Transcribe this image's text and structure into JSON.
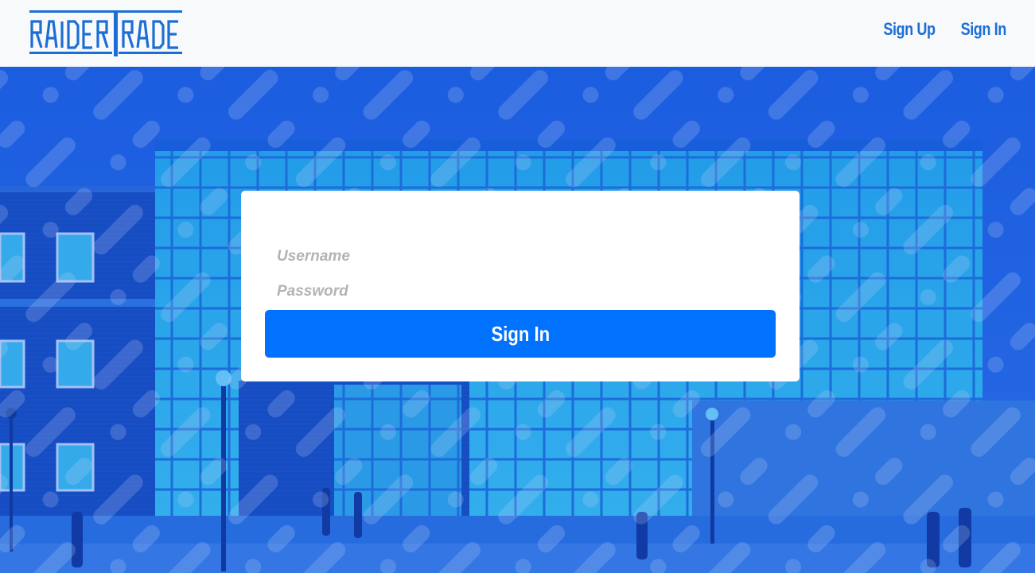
{
  "brand": {
    "name": "RAIDERTRADE",
    "color": "#1c6ed6"
  },
  "nav": {
    "signup_label": "Sign Up",
    "signin_label": "Sign In"
  },
  "login": {
    "username_placeholder": "Username",
    "username_value": "",
    "password_placeholder": "Password",
    "password_value": "",
    "submit_label": "Sign In"
  },
  "colors": {
    "overlay_blue": "#1f63e0",
    "button_blue": "#0072ff",
    "header_bg": "#f8f9fa"
  }
}
